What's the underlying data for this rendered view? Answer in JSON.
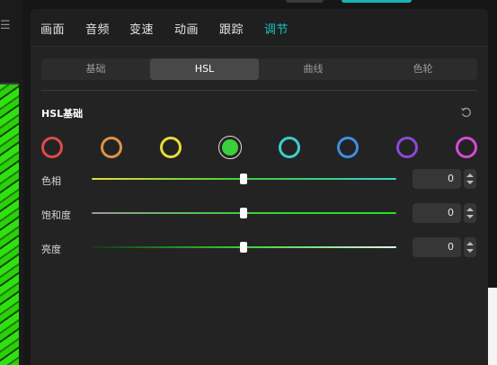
{
  "left": {
    "menu_icon": "hamburger-icon"
  },
  "tabs": [
    {
      "label": "画面",
      "active": false
    },
    {
      "label": "音频",
      "active": false
    },
    {
      "label": "变速",
      "active": false
    },
    {
      "label": "动画",
      "active": false
    },
    {
      "label": "跟踪",
      "active": false
    },
    {
      "label": "调节",
      "active": true
    }
  ],
  "subtabs": [
    {
      "label": "基础",
      "active": false
    },
    {
      "label": "HSL",
      "active": true
    },
    {
      "label": "曲线",
      "active": false
    },
    {
      "label": "色轮",
      "active": false
    }
  ],
  "section": {
    "title": "HSL基础",
    "reset_icon": "reset-icon"
  },
  "swatches": [
    {
      "name": "red",
      "color": "#e04a4a",
      "selected": false
    },
    {
      "name": "orange",
      "color": "#e0914a",
      "selected": false
    },
    {
      "name": "yellow",
      "color": "#e6dc3c",
      "selected": false
    },
    {
      "name": "green",
      "color": "#3ccf3c",
      "selected": true
    },
    {
      "name": "cyan",
      "color": "#3ccfcf",
      "selected": false
    },
    {
      "name": "blue",
      "color": "#3c8fe0",
      "selected": false
    },
    {
      "name": "purple",
      "color": "#8a4ad6",
      "selected": false
    },
    {
      "name": "magenta",
      "color": "#d64ad6",
      "selected": false
    }
  ],
  "sliders": [
    {
      "label": "色相",
      "value": "0",
      "gradient": [
        "#e6dc3c",
        "#3ccf3c",
        "#3ccfcf"
      ]
    },
    {
      "label": "饱和度",
      "value": "0",
      "gradient": [
        "#9a9a9a",
        "#3ccf3c",
        "#1ee61e"
      ]
    },
    {
      "label": "亮度",
      "value": "0",
      "gradient": [
        "#0f3a0f",
        "#3ccf3c",
        "#dff5df"
      ]
    }
  ],
  "colors": {
    "accent": "#19c3c3",
    "panel": "#232323"
  }
}
